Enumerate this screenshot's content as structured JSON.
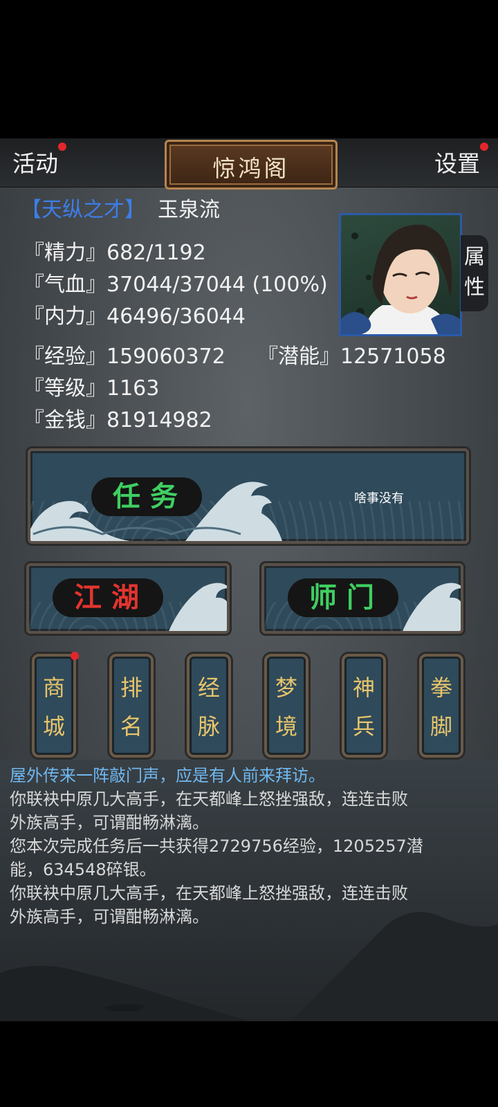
{
  "header": {
    "activity_label": "活动",
    "title": "惊鸿阁",
    "settings_label": "设置"
  },
  "profile": {
    "rank": "【天纵之才】",
    "name": "玉泉流",
    "attr_tab": [
      "属",
      "性"
    ]
  },
  "stats": {
    "energy": "『精力』682/1192",
    "hp": "『气血』37044/37044 (100%)",
    "inner": "『内力』46496/36044",
    "exp": "『经验』159060372",
    "potential": "『潜能』12571058",
    "level": "『等级』1163",
    "money": "『金钱』81914982"
  },
  "panels": {
    "quest_label": "任务",
    "quest_note": "啥事没有",
    "jianghu_label": "江湖",
    "sect_label": "师门"
  },
  "small_buttons": [
    {
      "top": "商",
      "bottom": "城"
    },
    {
      "top": "排",
      "bottom": "名"
    },
    {
      "top": "经",
      "bottom": "脉"
    },
    {
      "top": "梦",
      "bottom": "境"
    },
    {
      "top": "神",
      "bottom": "兵"
    },
    {
      "top": "拳",
      "bottom": "脚"
    }
  ],
  "log": [
    "屋外传来一阵敲门声，应是有人前来拜访。",
    "你联袂中原几大高手，在天都峰上怒挫强敌，连连击败",
    "外族高手，可谓酣畅淋漓。",
    "您本次完成任务后一共获得2729756经验，1205257潜",
    "能，634548碎银。",
    "你联袂中原几大高手，在天都峰上怒挫强敌，连连击败",
    "外族高手，可谓酣畅淋漓。"
  ],
  "colors": {
    "rank": "#3d7ee8",
    "notification_dot": "#e3262b",
    "quest_text": "#3fcf62",
    "jianghu_text": "#e2352f",
    "button_text": "#e8c56b",
    "log_highlight": "#6fb8f0"
  }
}
